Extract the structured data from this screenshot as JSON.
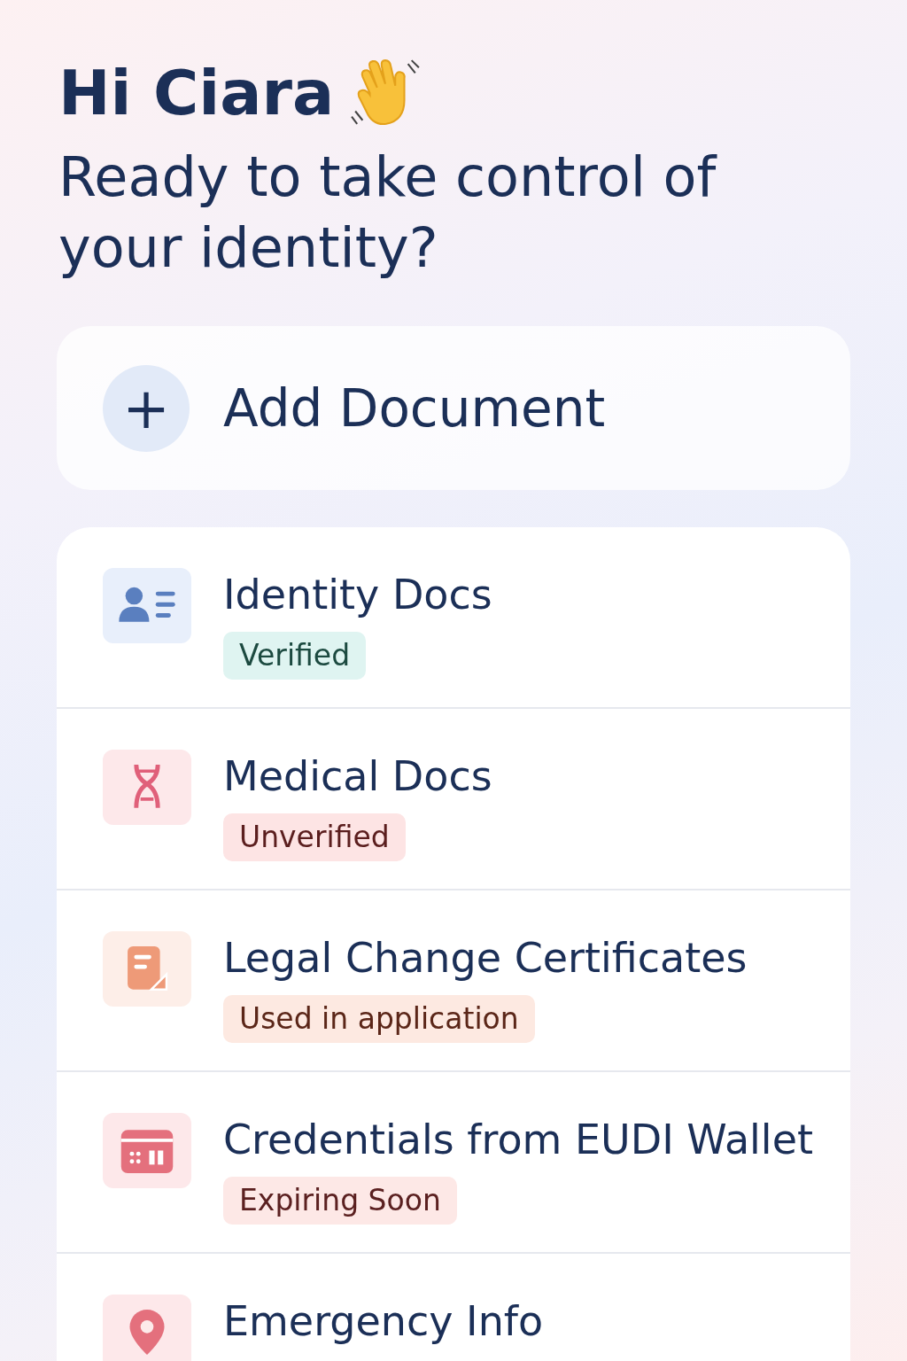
{
  "greeting": {
    "title": "Hi Ciara",
    "subtitle": "Ready to take control of your identity?"
  },
  "add_button": {
    "icon": "+",
    "label": "Add Document"
  },
  "categories": [
    {
      "kind": "id-card",
      "title": "Identity Docs",
      "badge": {
        "label": "Verified",
        "kind": "verified"
      }
    },
    {
      "kind": "dna",
      "title": "Medical Docs",
      "badge": {
        "label": "Unverified",
        "kind": "unverified"
      }
    },
    {
      "kind": "document",
      "title": "Legal Change Certificates",
      "badge": {
        "label": "Used in application",
        "kind": "used"
      }
    },
    {
      "kind": "wallet",
      "title": "Credentials from EUDI Wallet",
      "badge": {
        "label": "Expiring Soon",
        "kind": "expiring"
      }
    },
    {
      "kind": "pin",
      "title": "Emergency Info"
    }
  ]
}
